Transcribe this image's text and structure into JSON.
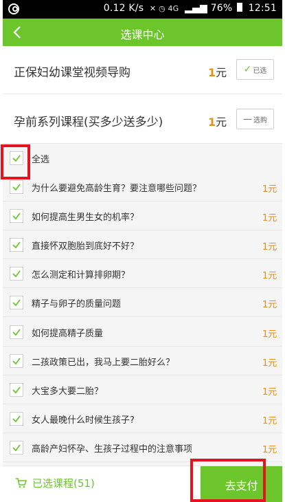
{
  "status_bar": {
    "speed": "0.12 K/s",
    "icons": "✕ ◷ 4G",
    "battery": "76%",
    "time": "12:51"
  },
  "header": {
    "title": "选课中心"
  },
  "packages": [
    {
      "name": "正保妇幼课堂视频导购",
      "price_num": "1",
      "price_unit": "元",
      "button_label": "已选",
      "selected": true
    },
    {
      "name": "孕前系列课程(买多少送多少)",
      "price_num": "1",
      "price_unit": "元",
      "button_label": "选购",
      "selected": false
    }
  ],
  "select_all": {
    "label": "全选",
    "checked": true
  },
  "courses": [
    {
      "title": "为什么要避免高龄生育？要注意哪些问题？",
      "price": "1元",
      "checked": true
    },
    {
      "title": "如何提高生男生女的机率？",
      "price": "1元",
      "checked": true
    },
    {
      "title": "直接怀双胞胎到底好不好？",
      "price": "1元",
      "checked": true
    },
    {
      "title": "怎么测定和计算排卵期？",
      "price": "1元",
      "checked": true
    },
    {
      "title": "精子与卵子的质量问题",
      "price": "1元",
      "checked": true
    },
    {
      "title": "如何提高精子质量",
      "price": "1元",
      "checked": true
    },
    {
      "title": "二孩政策已出，我马上要二胎好么？",
      "price": "1元",
      "checked": true
    },
    {
      "title": "大宝多大要二胎？",
      "price": "1元",
      "checked": true
    },
    {
      "title": "女人最晚什么时候生孩子?",
      "price": "1元",
      "checked": true
    },
    {
      "title": "高龄产妇怀孕、生孩子过程中的注意事项",
      "price": "1元",
      "checked": true
    }
  ],
  "bottom_bar": {
    "cart_label": "已选课程(51)",
    "pay_label": "去支付"
  },
  "colors": {
    "brand_green": "#6cc62b",
    "price_orange": "#e88e14",
    "highlight_red": "#e3141f"
  }
}
